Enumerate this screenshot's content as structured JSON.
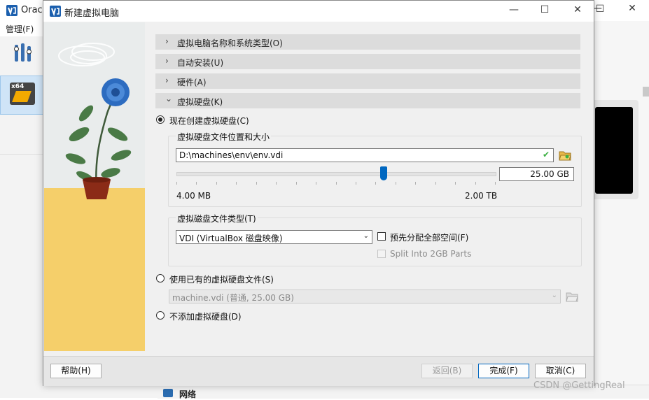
{
  "background_window": {
    "title": "Orac",
    "menu_manage": "管理(F)",
    "vm_item_badge": "x64",
    "network_label": "网络",
    "watermark": "CSDN @GettingReal"
  },
  "dialog": {
    "title": "新建虚拟电脑",
    "window_controls": {
      "minimize": "—",
      "maximize": "☐",
      "close": "✕"
    },
    "sections": [
      {
        "label": "虚拟电脑名称和系统类型(O)",
        "expanded": false
      },
      {
        "label": "自动安装(U)",
        "expanded": false
      },
      {
        "label": "硬件(A)",
        "expanded": false
      },
      {
        "label": "虚拟硬盘(K)",
        "expanded": true
      }
    ],
    "chevrons": {
      "collapsed": "›",
      "expanded": "⌄"
    },
    "options": {
      "create_new": "现在创建虚拟硬盘(C)",
      "use_existing": "使用已有的虚拟硬盘文件(S)",
      "no_disk": "不添加虚拟硬盘(D)"
    },
    "location_group": {
      "label": "虚拟硬盘文件位置和大小",
      "path_value": "D:\\machines\\env\\env.vdi",
      "size_value": "25.00 GB",
      "slider_fraction": 0.65,
      "min_label": "4.00 MB",
      "max_label": "2.00 TB"
    },
    "type_group": {
      "label": "虚拟磁盘文件类型(T)",
      "selected": "VDI (VirtualBox 磁盘映像)",
      "preallocate_label": "预先分配全部空间(F)",
      "split_label": "Split Into 2GB Parts"
    },
    "existing_select": "machine.vdi (普通, 25.00 GB)",
    "buttons": {
      "help": "帮助(H)",
      "back": "返回(B)",
      "finish": "完成(F)",
      "cancel": "取消(C)"
    },
    "colors": {
      "accent": "#0067c0",
      "floor": "#f5cf6a",
      "ok_check": "#3cb043"
    }
  }
}
